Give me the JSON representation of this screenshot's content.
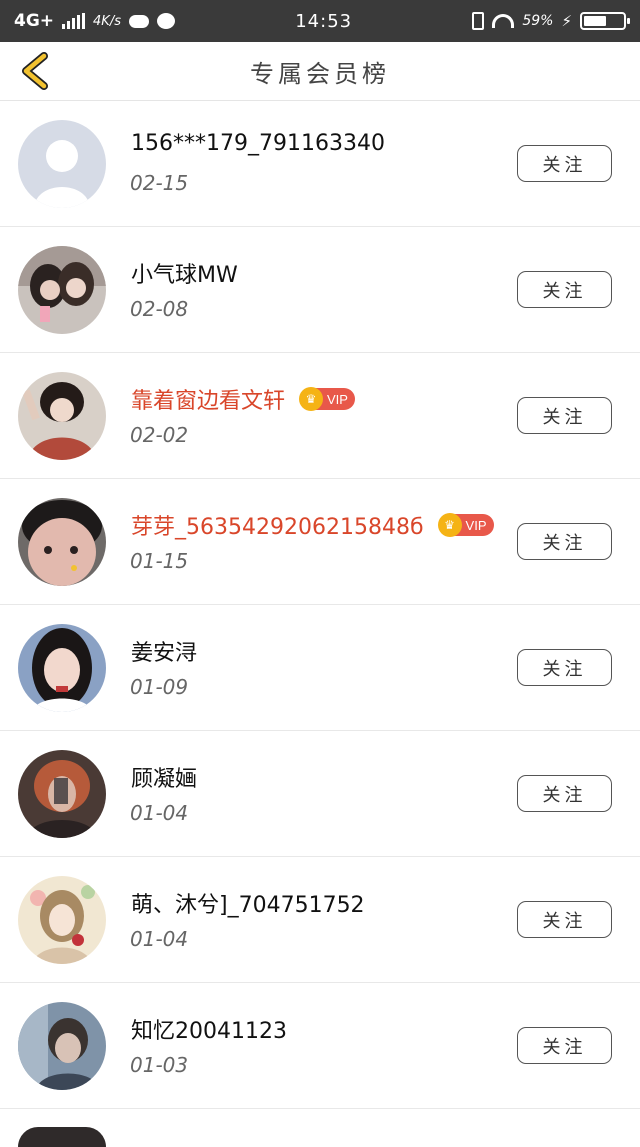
{
  "status": {
    "network": "4G+",
    "speed": "4K/s",
    "time": "14:53",
    "battery": "59%"
  },
  "header": {
    "title": "专属会员榜",
    "back_icon": "chevron-left-icon",
    "accent": "#f2c230"
  },
  "members": [
    {
      "name": "156***179_791163340",
      "date": "02-15",
      "vip": false,
      "follow": "关注"
    },
    {
      "name": "小气球MW",
      "date": "02-08",
      "vip": false,
      "follow": "关注"
    },
    {
      "name": "靠着窗边看文轩",
      "date": "02-02",
      "vip": true,
      "vip_label": "VIP",
      "follow": "关注"
    },
    {
      "name": "芽芽_5635429206215848б",
      "date": "01-15",
      "vip": true,
      "vip_label": "VIP",
      "follow": "关注"
    },
    {
      "name": "姜安浔",
      "date": "01-09",
      "vip": false,
      "follow": "关注"
    },
    {
      "name": "顾凝婳",
      "date": "01-04",
      "vip": false,
      "follow": "关注"
    },
    {
      "name": "萌、沐兮]_704751752",
      "date": "01-04",
      "vip": false,
      "follow": "关注"
    },
    {
      "name": "知忆20041123",
      "date": "01-03",
      "vip": false,
      "follow": "关注"
    }
  ],
  "colors": {
    "vip_name": "#d9462a",
    "vip_badge": "#e8584a",
    "crown": "#f5b315"
  }
}
